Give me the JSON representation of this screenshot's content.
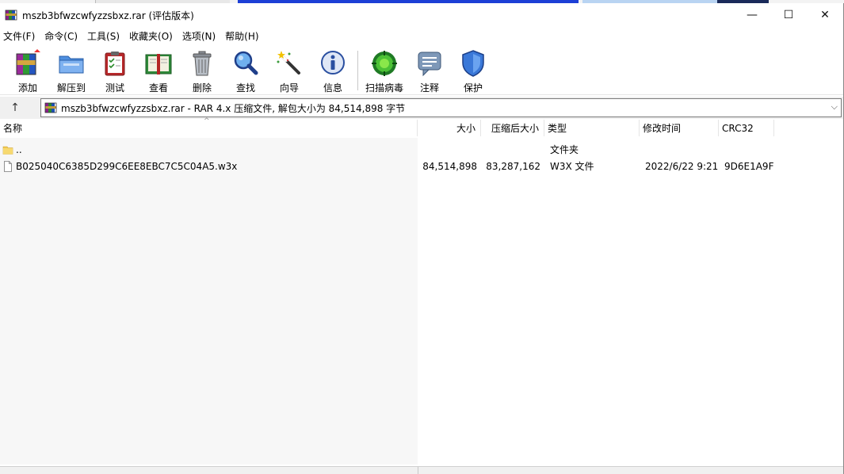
{
  "window": {
    "title": "mszb3bfwzcwfyzzsbxz.rar (评估版本)",
    "minimize": "—",
    "maximize": "☐",
    "close": "✕"
  },
  "menu": [
    "文件(F)",
    "命令(C)",
    "工具(S)",
    "收藏夹(O)",
    "选项(N)",
    "帮助(H)"
  ],
  "toolbar": {
    "add": "添加",
    "extract": "解压到",
    "test": "测试",
    "view": "查看",
    "delete": "删除",
    "find": "查找",
    "wizard": "向导",
    "info": "信息",
    "scan": "扫描病毒",
    "comment": "注释",
    "protect": "保护"
  },
  "address": {
    "up": "↑",
    "text": "mszb3bfwzcwfyzzsbxz.rar - RAR 4.x 压缩文件, 解包大小为 84,514,898 字节",
    "dropdown": "⌵"
  },
  "columns": {
    "name": "名称",
    "size": "大小",
    "packed": "压缩后大小",
    "type": "类型",
    "modified": "修改时间",
    "crc": "CRC32"
  },
  "rows": [
    {
      "name": "..",
      "size": "",
      "packed": "",
      "type": "文件夹",
      "modified": "",
      "crc": "",
      "icon": "folder-icon"
    },
    {
      "name": "B025040C6385D299C6EE8EBC7C5C04A5.w3x",
      "size": "84,514,898",
      "packed": "83,287,162",
      "type": "W3X 文件",
      "modified": "2022/6/22 9:21",
      "crc": "9D6E1A9F",
      "icon": "file-icon"
    }
  ],
  "colors": {
    "accent": "#1d3fd6",
    "separator": "#c8c8c8"
  }
}
